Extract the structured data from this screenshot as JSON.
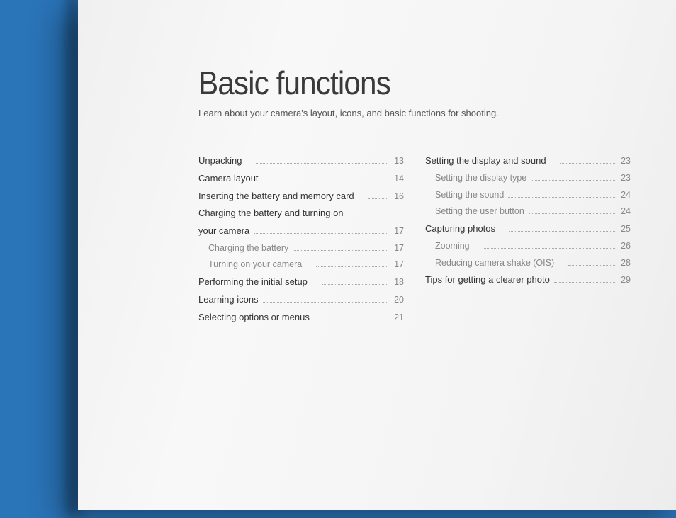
{
  "title": "Basic functions",
  "subtitle": "Learn about your camera's layout, icons, and basic functions for shooting.",
  "leftColumn": [
    {
      "label": "Unpacking",
      "page": "13",
      "sub": false,
      "gap": true
    },
    {
      "label": "Camera layout",
      "page": "14",
      "sub": false
    },
    {
      "label": "Inserting the battery and memory card",
      "page": "16",
      "sub": false,
      "gap": true
    },
    {
      "label": "Charging the battery and turning on",
      "page": "",
      "sub": false,
      "nolead": true
    },
    {
      "label": "your camera",
      "page": "17",
      "sub": false
    },
    {
      "label": "Charging the battery",
      "page": "17",
      "sub": true
    },
    {
      "label": "Turning on your camera",
      "page": "17",
      "sub": true,
      "gap": true
    },
    {
      "label": "Performing the initial setup",
      "page": "18",
      "sub": false,
      "gap": true
    },
    {
      "label": "Learning icons",
      "page": "20",
      "sub": false
    },
    {
      "label": "Selecting options or menus",
      "page": "21",
      "sub": false,
      "gap": true
    }
  ],
  "rightColumn": [
    {
      "label": "Setting the display and sound",
      "page": "23",
      "sub": false,
      "gap": true
    },
    {
      "label": "Setting the display type",
      "page": "23",
      "sub": true
    },
    {
      "label": "Setting the sound",
      "page": "24",
      "sub": true
    },
    {
      "label": "Setting the user button",
      "page": "24",
      "sub": true
    },
    {
      "label": "Capturing photos",
      "page": "25",
      "sub": false,
      "gap": true
    },
    {
      "label": "Zooming",
      "page": "26",
      "sub": true,
      "gap": true
    },
    {
      "label": "Reducing camera shake (OIS)",
      "page": "28",
      "sub": true,
      "gap": true
    },
    {
      "label": "Tips for getting a clearer photo",
      "page": "29",
      "sub": false
    }
  ]
}
